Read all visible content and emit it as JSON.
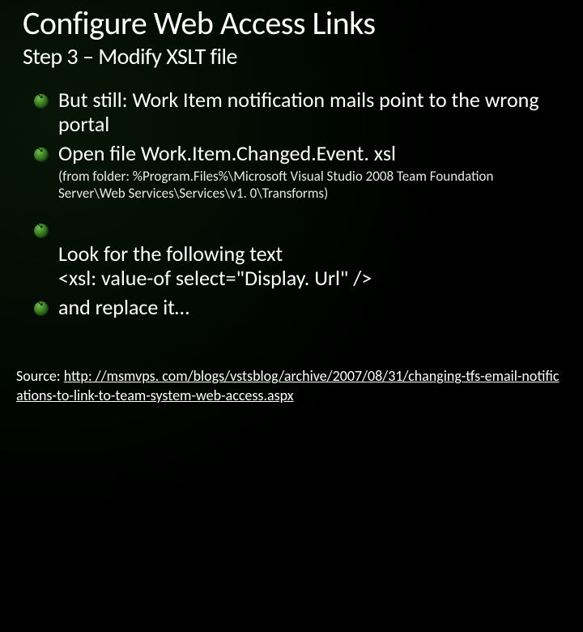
{
  "title": "Configure Web Access Links",
  "subtitle": "Step 3 – Modify XSLT file",
  "bullets": [
    {
      "text": "But still: Work Item notification mails point to the wrong portal"
    },
    {
      "text": "Open file Work.Item.Changed.Event. xsl",
      "sub": "(from folder: %Program.Files%\\Microsoft Visual Studio 2008 Team Foundation Server\\Web Services\\Services\\v1. 0\\Transforms)"
    },
    {
      "text": "Look for the following text\n<xsl: value-of select=\"Display. Url\" />",
      "spacer_before": true
    },
    {
      "text": "and replace it…"
    }
  ],
  "source_label": "Source: ",
  "source_url_text": "http: //msmvps. com/blogs/vstsblog/archive/2007/08/31/changing-tfs-email-notifications-to-link-to-team-system-web-access.aspx"
}
